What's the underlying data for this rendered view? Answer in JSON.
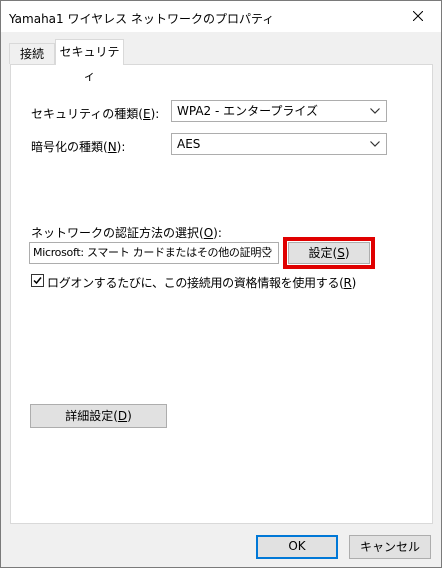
{
  "window": {
    "title": "Yamaha1 ワイヤレス ネットワークのプロパティ"
  },
  "tabs": [
    {
      "label": "接続"
    },
    {
      "label": "セキュリティ"
    }
  ],
  "security": {
    "security_type": {
      "label_prefix": "セキュリティの種類(",
      "mnemonic": "E",
      "label_suffix": "):",
      "value": "WPA2 - エンタープライズ"
    },
    "encryption_type": {
      "label_prefix": "暗号化の種類(",
      "mnemonic": "N",
      "label_suffix": "):",
      "value": "AES"
    },
    "auth_method": {
      "label_prefix": "ネットワークの認証方法の選択(",
      "mnemonic": "O",
      "label_suffix": "):",
      "value": "Microsoft: スマート カードまたはその他の証明書",
      "settings_button": {
        "label_prefix": "設定(",
        "mnemonic": "S",
        "label_suffix": ")"
      }
    },
    "remember_credentials": {
      "checked": true,
      "label_prefix": "ログオンするたびに、この接続用の資格情報を使用する(",
      "mnemonic": "R",
      "label_suffix": ")"
    },
    "advanced_button": {
      "label_prefix": "詳細設定(",
      "mnemonic": "D",
      "label_suffix": ")"
    }
  },
  "footer": {
    "ok_label": "OK",
    "cancel_label": "キャンセル"
  },
  "colors": {
    "highlight": "#e00000",
    "primary_border": "#0078d7"
  },
  "icons": {
    "close": "close-icon",
    "dropdown": "chevron-down-icon",
    "check": "check-icon"
  }
}
